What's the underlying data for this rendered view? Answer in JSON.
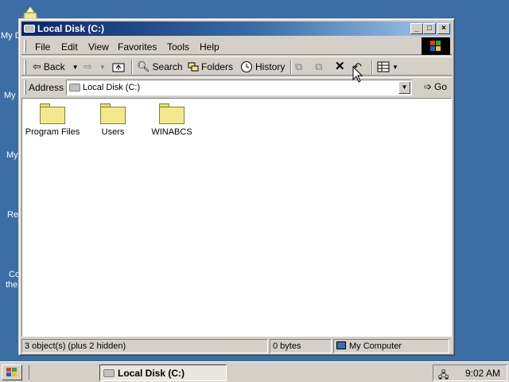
{
  "desktop": {
    "labels": [
      "My D",
      "My",
      "My",
      "Re",
      "Co",
      "the"
    ]
  },
  "window": {
    "title": "Local Disk (C:)",
    "menu": [
      "File",
      "Edit",
      "View",
      "Favorites",
      "Tools",
      "Help"
    ],
    "toolbar": {
      "back": "Back",
      "search": "Search",
      "folders": "Folders",
      "history": "History"
    },
    "address": {
      "label": "Address",
      "value": "Local Disk (C:)",
      "go": "Go"
    },
    "files": [
      {
        "name": "Program Files"
      },
      {
        "name": "Users"
      },
      {
        "name": "WINABCS"
      }
    ],
    "status": {
      "objects": "3 object(s) (plus 2 hidden)",
      "size": "0 bytes",
      "zone": "My Computer"
    }
  },
  "taskbar": {
    "task": "Local Disk (C:)",
    "clock": "9:02 AM"
  },
  "colors": {
    "desktop": "#3a6ea5",
    "title_active": "#0a246a",
    "chrome": "#d4d0c8"
  }
}
